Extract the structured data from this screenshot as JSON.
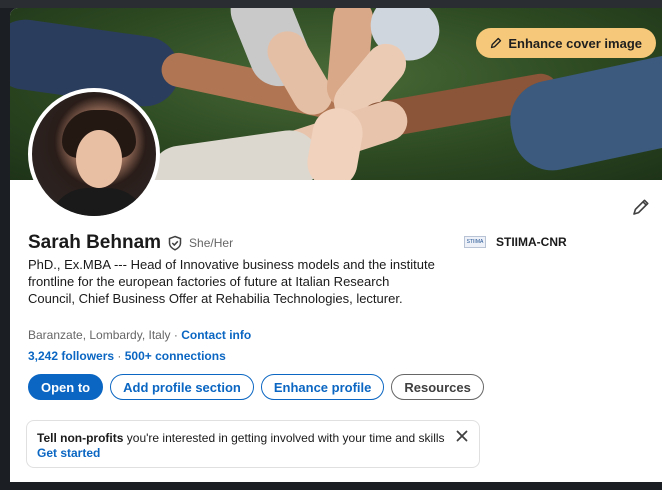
{
  "cover": {
    "enhance_label": "Enhance cover image",
    "icons": [
      "pencil-icon"
    ]
  },
  "profile": {
    "name": "Sarah Behnam",
    "pronouns": "She/Her",
    "headline": "PhD., Ex.MBA --- Head of Innovative business models and the institute frontline for the european factories of future at Italian Research Council, Chief Business Offer at Rehabilia Technologies, lecturer.",
    "location": "Baranzate, Lombardy, Italy",
    "location_sep": " · ",
    "contact_info": "Contact info",
    "followers": "3,242 followers",
    "followers_sep": " · ",
    "connections": "500+ connections",
    "organization": "STIIMA-CNR",
    "org_logo_text": "STIIMA"
  },
  "actions": {
    "open_to": "Open to",
    "add_section": "Add profile section",
    "enhance_profile": "Enhance profile",
    "resources": "Resources"
  },
  "banner": {
    "bold_text": "Tell non-profits",
    "rest_text": " you're interested in getting involved with your time and skills",
    "link": "Get started"
  },
  "colors": {
    "brand_blue": "#0a66c2",
    "cover_button": "#f6c879"
  }
}
